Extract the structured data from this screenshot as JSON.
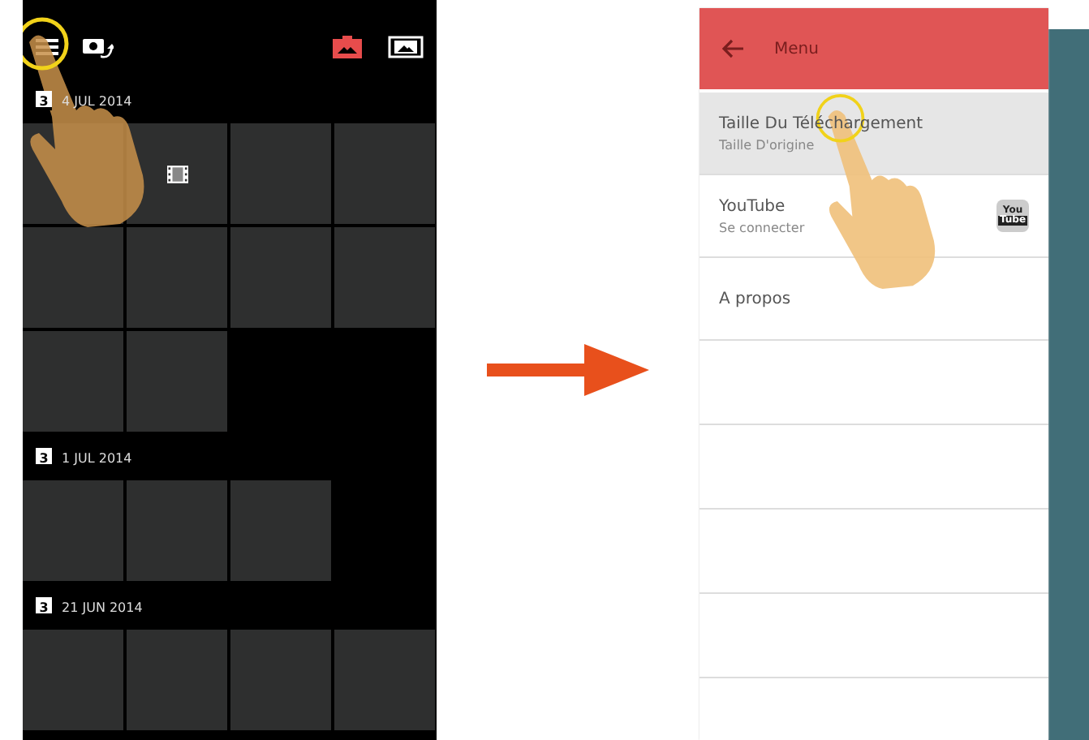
{
  "gallery": {
    "view_toggles": [
      {
        "selected": true
      },
      {
        "selected": false
      }
    ],
    "groups": [
      {
        "date": "4 JUL 2014",
        "calendar_day": "3",
        "tiles": [
          {
            "kind": "photo"
          },
          {
            "kind": "video"
          },
          {
            "kind": "photo"
          },
          {
            "kind": "photo"
          },
          {
            "kind": "photo"
          },
          {
            "kind": "photo"
          },
          {
            "kind": "photo"
          },
          {
            "kind": "photo"
          },
          {
            "kind": "photo"
          },
          {
            "kind": "photo"
          }
        ]
      },
      {
        "date": "1 JUL 2014",
        "calendar_day": "3",
        "tiles": [
          {
            "kind": "photo"
          },
          {
            "kind": "photo"
          },
          {
            "kind": "photo"
          }
        ]
      },
      {
        "date": "21 JUN 2014",
        "calendar_day": "3",
        "tiles": [
          {
            "kind": "photo"
          },
          {
            "kind": "photo"
          },
          {
            "kind": "photo"
          },
          {
            "kind": "photo"
          }
        ]
      }
    ]
  },
  "menu": {
    "title": "Menu",
    "items": [
      {
        "title": "Taille Du Téléchargement",
        "subtitle": "Taille D'origine",
        "selected": true
      },
      {
        "title": "YouTube",
        "subtitle": "Se connecter",
        "selected": false,
        "logo": [
          "You",
          "Tube"
        ]
      },
      {
        "title": "A propos",
        "selected": false
      }
    ]
  }
}
